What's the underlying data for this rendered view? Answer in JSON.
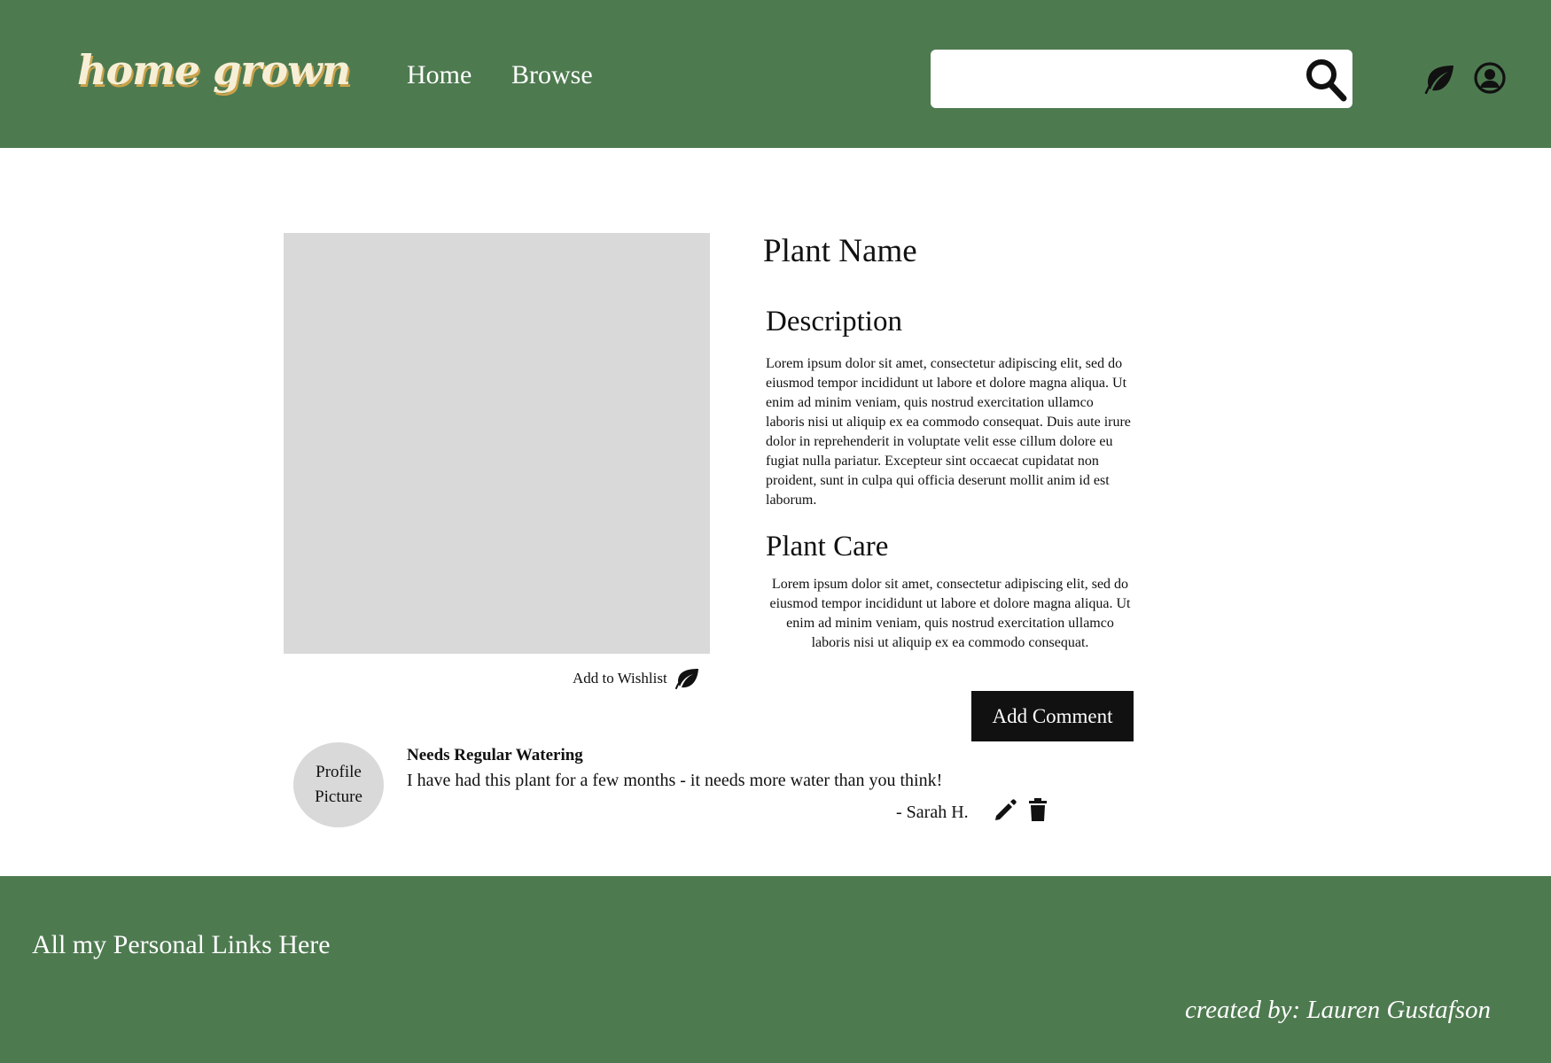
{
  "header": {
    "logo": "home grown",
    "nav": {
      "home": "Home",
      "browse": "Browse"
    },
    "search": {
      "value": "",
      "placeholder": ""
    },
    "icons": {
      "search": "search-icon",
      "wishlist": "leaf-icon",
      "account": "user-circle-icon"
    },
    "background_color": "#4e7a50"
  },
  "plant": {
    "name": "Plant Name",
    "wishlist_label": "Add to Wishlist",
    "description_heading": "Description",
    "description": "Lorem ipsum dolor sit amet, consectetur adipiscing elit, sed do eiusmod tempor incididunt ut labore et dolore magna aliqua. Ut enim ad minim veniam, quis nostrud exercitation ullamco laboris nisi ut aliquip ex ea commodo consequat. Duis aute irure dolor in reprehenderit in voluptate velit esse cillum dolore eu fugiat nulla pariatur. Excepteur sint occaecat cupidatat non proident, sunt in culpa qui officia deserunt mollit anim id est laborum.",
    "care_heading": "Plant Care",
    "care": "Lorem ipsum dolor sit amet, consectetur adipiscing elit, sed do eiusmod tempor incididunt ut labore et dolore magna aliqua. Ut enim ad minim veniam, quis nostrud exercitation ullamco laboris nisi ut aliquip ex ea commodo consequat."
  },
  "comments": {
    "add_label": "Add Comment",
    "items": [
      {
        "avatar_text": "Profile Picture",
        "title": "Needs Regular Watering",
        "body": "I have had this plant for a few months - it needs more water than you think!",
        "author": "- Sarah H."
      }
    ]
  },
  "footer": {
    "links": "All my Personal Links Here",
    "credit": "created by: Lauren Gustafson"
  }
}
